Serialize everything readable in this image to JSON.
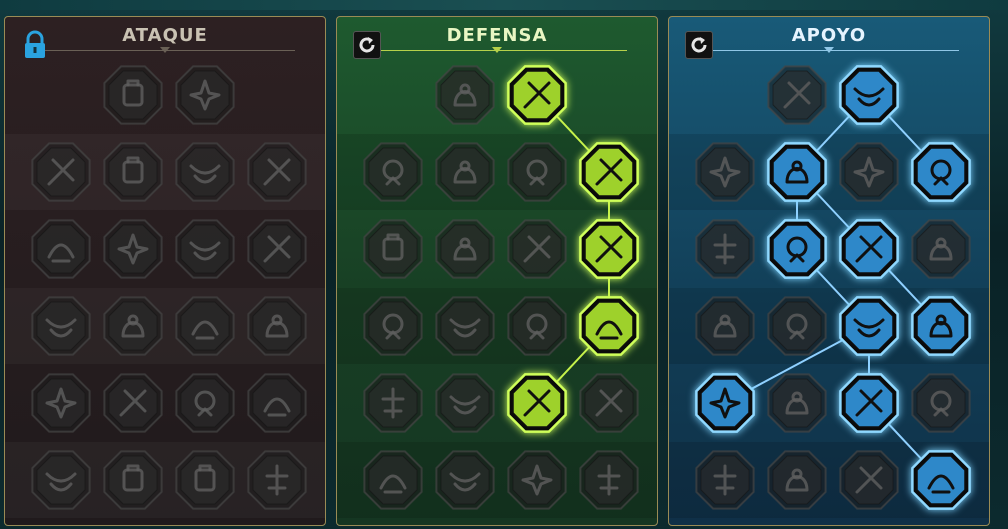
{
  "colors": {
    "ataque": "#2a1e20",
    "defensa": "#1d4a2a",
    "apoyo": "#143a52",
    "locked_accent": "#2aa3e0",
    "defensa_active_fill": "#9ed12b",
    "defensa_active_border": "#cfff5a",
    "apoyo_active_fill": "#2e88c9",
    "apoyo_active_border": "#8fd8ff",
    "inactive_fill": "#2b2b2b",
    "inactive_border": "#3a3a3a"
  },
  "panels": [
    {
      "id": "ataque",
      "title": "ATAQUE",
      "header_icon": "lock-icon",
      "theme": "ataque",
      "rows": [
        [
          null,
          {
            "icon": "sword-icon",
            "active": false
          },
          {
            "icon": "daggers-icon",
            "active": false
          },
          null
        ],
        [
          {
            "icon": "demon-icon",
            "active": false
          },
          {
            "icon": "claw-icon",
            "active": false
          },
          {
            "icon": "shield-strike-icon",
            "active": false
          },
          {
            "icon": "bleeding-heart-icon",
            "active": false
          }
        ],
        [
          {
            "icon": "fist-icon",
            "active": false
          },
          {
            "icon": "jaws-icon",
            "active": false
          },
          {
            "icon": "bomb-icon",
            "active": false
          },
          {
            "icon": "slash-icon",
            "active": false
          }
        ],
        [
          {
            "icon": "heart-target-icon",
            "active": false
          },
          {
            "icon": "gauntlet-icon",
            "active": false
          },
          {
            "icon": "axe-icon",
            "active": false
          },
          {
            "icon": "chain-lightning-icon",
            "active": false
          }
        ],
        [
          {
            "icon": "fan-blades-icon",
            "active": false
          },
          {
            "icon": "skull-icon",
            "active": false
          },
          {
            "icon": "rune-icon",
            "active": false
          },
          {
            "icon": "warrior-icon",
            "active": false
          }
        ],
        [
          {
            "icon": "cleave-icon",
            "active": false
          },
          {
            "icon": "helmet-icon",
            "active": false
          },
          {
            "icon": "beast-icon",
            "active": false
          },
          {
            "icon": "skull-crown-icon",
            "active": false
          }
        ]
      ],
      "links": []
    },
    {
      "id": "defensa",
      "title": "DEFENSA",
      "header_icon": "refresh-icon",
      "theme": "defensa",
      "rows": [
        [
          null,
          {
            "icon": "armor-plate-icon",
            "active": false
          },
          {
            "icon": "raised-fist-icon",
            "active": true
          },
          null
        ],
        [
          {
            "icon": "cloak-icon",
            "active": false
          },
          {
            "icon": "heart-guard-icon",
            "active": false
          },
          {
            "icon": "brute-icon",
            "active": false
          },
          {
            "icon": "crossed-blades-icon",
            "active": true
          }
        ],
        [
          {
            "icon": "tornado-icon",
            "active": false
          },
          {
            "icon": "banner-shield-icon",
            "active": false
          },
          {
            "icon": "skull-orb-icon",
            "active": false
          },
          {
            "icon": "monk-aura-icon",
            "active": true
          }
        ],
        [
          {
            "icon": "hooded-figure-icon",
            "active": false
          },
          {
            "icon": "hourglass-icon",
            "active": false
          },
          {
            "icon": "open-hand-icon",
            "active": false
          },
          {
            "icon": "bull-head-icon",
            "active": true
          }
        ],
        [
          {
            "icon": "running-icon",
            "active": false
          },
          {
            "icon": "triple-blades-icon",
            "active": false
          },
          {
            "icon": "radiant-skull-icon",
            "active": true
          },
          {
            "icon": "wave-icon",
            "active": false
          }
        ],
        [
          {
            "icon": "skull-helm-icon",
            "active": false
          },
          {
            "icon": "shield-rune-icon",
            "active": false
          },
          {
            "icon": "octopus-icon",
            "active": false
          },
          {
            "icon": "strongman-icon",
            "active": false
          }
        ]
      ],
      "links": [
        [
          0,
          2,
          1,
          3
        ],
        [
          1,
          3,
          2,
          3
        ],
        [
          2,
          3,
          3,
          3
        ],
        [
          3,
          3,
          4,
          2
        ]
      ]
    },
    {
      "id": "apoyo",
      "title": "APOYO",
      "header_icon": "refresh-icon",
      "theme": "apoyo",
      "rows": [
        [
          null,
          {
            "icon": "heart-sparkle-icon",
            "active": false
          },
          {
            "icon": "vortex-hand-icon",
            "active": true
          },
          null
        ],
        [
          {
            "icon": "praying-hands-icon",
            "active": false
          },
          {
            "icon": "ward-shield-icon",
            "active": true
          },
          {
            "icon": "skull-flame-icon",
            "active": false
          },
          {
            "icon": "spirit-strike-icon",
            "active": true
          }
        ],
        [
          {
            "icon": "mystic-icon",
            "active": false
          },
          {
            "icon": "lightning-shield-icon",
            "active": true
          },
          {
            "icon": "shatter-icon",
            "active": true
          },
          {
            "icon": "ghost-figure-icon",
            "active": false
          }
        ],
        [
          {
            "icon": "heart-chain-icon",
            "active": false
          },
          {
            "icon": "open-book-icon",
            "active": false
          },
          {
            "icon": "comet-icon",
            "active": true
          },
          {
            "icon": "angry-eyes-icon",
            "active": true
          }
        ],
        [
          {
            "icon": "compass-star-icon",
            "active": true
          },
          {
            "icon": "boot-icon",
            "active": false
          },
          {
            "icon": "eye-icon",
            "active": true
          },
          {
            "icon": "spin-icon",
            "active": false
          }
        ],
        [
          {
            "icon": "potion-icon",
            "active": false
          },
          {
            "icon": "skull-mask-icon",
            "active": false
          },
          {
            "icon": "warlord-icon",
            "active": false
          },
          {
            "icon": "eagle-icon",
            "active": true
          }
        ]
      ],
      "links": [
        [
          0,
          2,
          1,
          1
        ],
        [
          0,
          2,
          1,
          3
        ],
        [
          1,
          1,
          2,
          1
        ],
        [
          1,
          1,
          2,
          2
        ],
        [
          2,
          2,
          3,
          3
        ],
        [
          2,
          1,
          3,
          2
        ],
        [
          3,
          2,
          4,
          0
        ],
        [
          3,
          2,
          4,
          2
        ],
        [
          4,
          2,
          5,
          3
        ]
      ]
    }
  ]
}
